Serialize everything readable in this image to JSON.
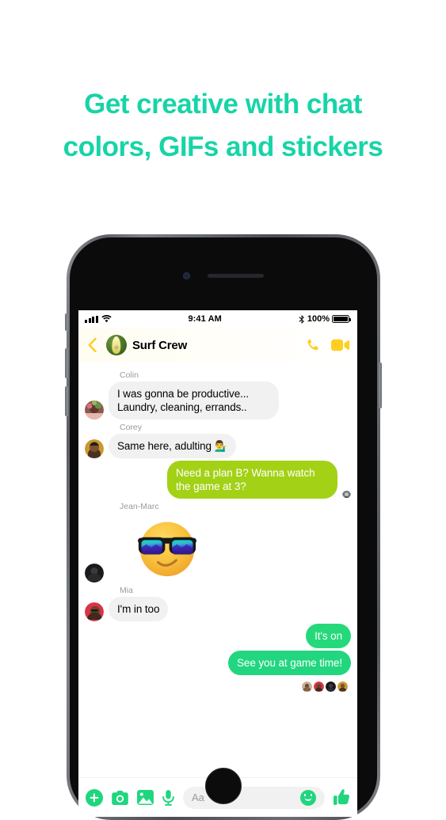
{
  "headline": {
    "line1": "Get creative with chat",
    "line2": "colors, GIFs and stickers",
    "color": "#17d4a7"
  },
  "status_bar": {
    "signal_icon": "cellular-bars-icon",
    "wifi_icon": "wifi-icon",
    "time": "9:41 AM",
    "bluetooth_icon": "bluetooth-icon",
    "battery_percent": "100%",
    "battery_icon": "battery-full-icon"
  },
  "chat_header": {
    "back_icon": "back-chevron-icon",
    "avatar_icon": "surfboard-avatar",
    "title": "Surf Crew",
    "call_icon": "phone-call-icon",
    "video_icon": "video-call-icon",
    "accent_color": "#ffce1f"
  },
  "messages": [
    {
      "sender": "Colin",
      "direction": "in",
      "text": "I was gonna be productive... Laundry, cleaning, errands..",
      "avatar": "colin-avatar"
    },
    {
      "sender": "Corey",
      "direction": "in",
      "text": "Same here, adulting 💁‍♂️",
      "avatar": "corey-avatar"
    },
    {
      "sender": "",
      "direction": "out",
      "text": "Need a plan B? Wanna watch the game at 3?",
      "bubble_color": "#a3d116",
      "avatar": "read-receipt-avatar"
    },
    {
      "sender": "Jean-Marc",
      "direction": "in",
      "text": "",
      "sticker": "cool-sunglasses-emoji-sticker",
      "avatar": "jean-marc-avatar"
    },
    {
      "sender": "Mia",
      "direction": "in",
      "text": "I'm in too",
      "avatar": "mia-avatar"
    },
    {
      "sender": "",
      "direction": "out",
      "text": "It's on",
      "bubble_color": "#25d97a"
    },
    {
      "sender": "",
      "direction": "out",
      "text": "See you at game time!",
      "bubble_color": "#22d67f"
    }
  ],
  "seen_by": [
    "seen-avatar-1",
    "seen-avatar-2",
    "seen-avatar-3",
    "seen-avatar-4"
  ],
  "composer": {
    "plus_icon": "add-plus-icon",
    "camera_icon": "camera-icon",
    "gallery_icon": "photo-gallery-icon",
    "mic_icon": "microphone-icon",
    "input_placeholder": "Aa",
    "emoji_icon": "smiley-emoji-icon",
    "like_icon": "thumbs-up-icon",
    "accent_color": "#1fd67f"
  }
}
